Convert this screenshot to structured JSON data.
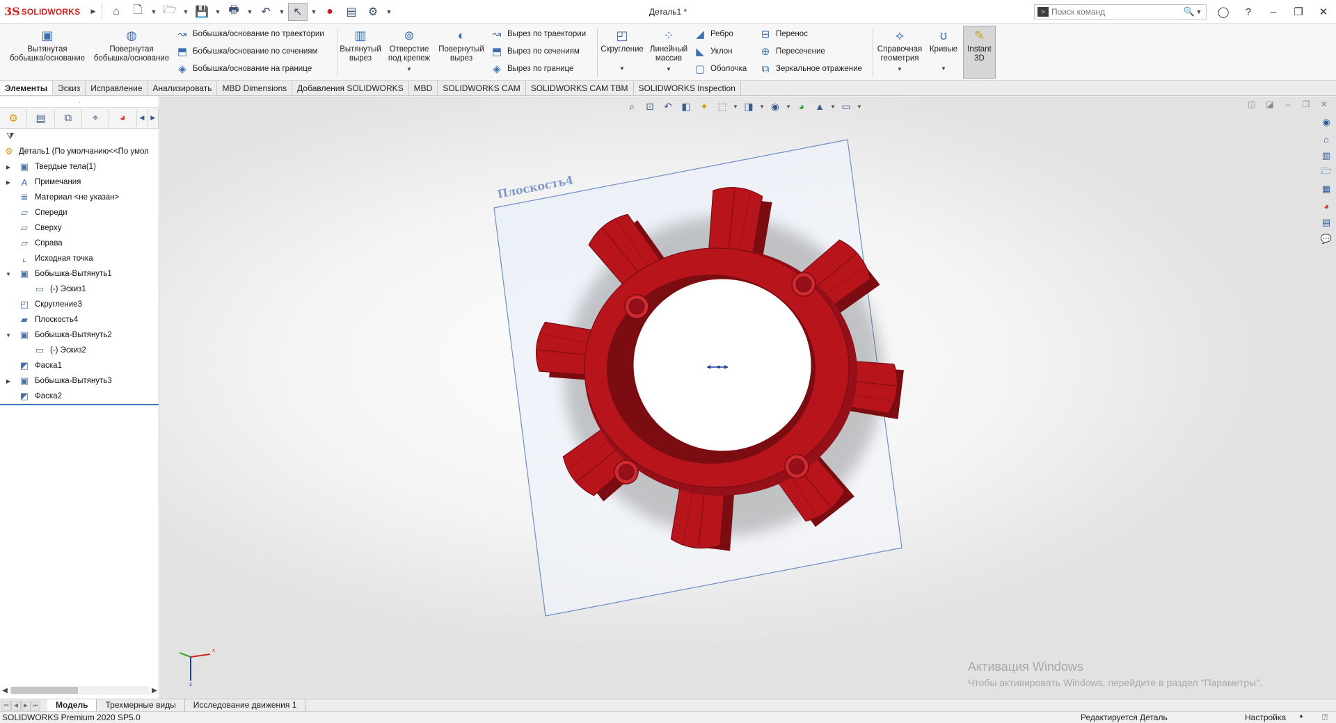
{
  "app": {
    "logo_mark": "3S",
    "logo_text": "SOLIDWORKS",
    "doc_title": "Деталь1 *"
  },
  "search": {
    "placeholder": "Поиск команд"
  },
  "command_manager": {
    "extruded_boss": "Вытянутая\nбобышка/основание",
    "revolved_boss": "Повернутая\nбобышка/основание",
    "swept_boss": "Бобышка/основание по траектории",
    "lofted_boss": "Бобышка/основание по сечениям",
    "boundary_boss": "Бобышка/основание на границе",
    "extruded_cut": "Вытянутый\nвырез",
    "hole_wizard": "Отверстие\nпод крепеж",
    "revolved_cut": "Повернутый\nвырез",
    "swept_cut": "Вырез по траектории",
    "lofted_cut": "Вырез по сечениям",
    "boundary_cut": "Вырез по границе",
    "fillet": "Скругление",
    "linear_pattern": "Линейный\nмассив",
    "rib": "Ребро",
    "draft": "Уклон",
    "shell": "Оболочка",
    "wrap": "Перенос",
    "intersect": "Пересечение",
    "mirror": "Зеркальное отражение",
    "ref_geometry": "Справочная\nгеометрия",
    "curves": "Кривые",
    "instant3d": "Instant\n3D"
  },
  "tabs": [
    "Элементы",
    "Эскиз",
    "Исправление",
    "Анализировать",
    "MBD Dimensions",
    "Добавления SOLIDWORKS",
    "MBD",
    "SOLIDWORKS CAM",
    "SOLIDWORKS CAM TBM",
    "SOLIDWORKS Inspection"
  ],
  "tree": {
    "root": "Деталь1  (По умолчанию<<По умол",
    "items": [
      {
        "label": "Твердые тела(1)",
        "icon": "solid-bodies-icon",
        "expander": "▶"
      },
      {
        "label": "Примечания",
        "icon": "annotations-icon",
        "expander": "▶"
      },
      {
        "label": "Материал <не указан>",
        "icon": "material-icon",
        "expander": ""
      },
      {
        "label": "Спереди",
        "icon": "plane-icon",
        "expander": ""
      },
      {
        "label": "Сверху",
        "icon": "plane-icon",
        "expander": ""
      },
      {
        "label": "Справа",
        "icon": "plane-icon",
        "expander": ""
      },
      {
        "label": "Исходная точка",
        "icon": "origin-icon",
        "expander": ""
      },
      {
        "label": "Бобышка-Вытянуть1",
        "icon": "extrude-feature-icon",
        "expander": "▼"
      },
      {
        "label": "(-) Эскиз1",
        "icon": "sketch-icon",
        "expander": ""
      },
      {
        "label": "Скругление3",
        "icon": "fillet-feature-icon",
        "expander": ""
      },
      {
        "label": "Плоскость4",
        "icon": "plane-feature-icon",
        "expander": ""
      },
      {
        "label": "Бобышка-Вытянуть2",
        "icon": "extrude-feature-icon",
        "expander": "▼"
      },
      {
        "label": "(-) Эскиз2",
        "icon": "sketch-icon",
        "expander": ""
      },
      {
        "label": "Фаска1",
        "icon": "chamfer-feature-icon",
        "expander": ""
      },
      {
        "label": "Бобышка-Вытянуть3",
        "icon": "extrude-feature-icon",
        "expander": "▶"
      },
      {
        "label": "Фаска2",
        "icon": "chamfer-feature-icon",
        "expander": ""
      }
    ]
  },
  "viewport": {
    "plane_label": "Плоскость4",
    "part_color": "#b8141c",
    "activation_title": "Активация Windows",
    "activation_text": "Чтобы активировать Windows, перейдите в раздел \"Параметры\"."
  },
  "bottom_tabs": [
    "Модель",
    "Трехмерные виды",
    "Исследование движения 1"
  ],
  "status": {
    "version": "SOLIDWORKS Premium 2020 SP5.0",
    "editing": "Редактируется Деталь",
    "custom": "Настройка"
  }
}
